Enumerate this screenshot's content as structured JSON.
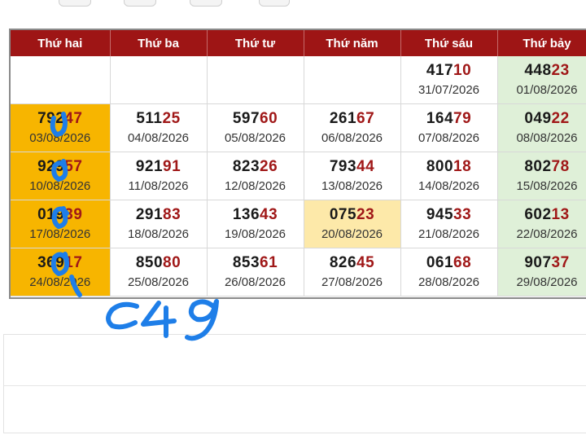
{
  "colors": {
    "header_bg": "#9e1515",
    "number_tail": "#a01818",
    "monday_bg": "#f7b500",
    "saturday_bg": "#dff0d8",
    "highlight_bg": "#fde9a9",
    "scribble": "#1e7ee8"
  },
  "calendar": {
    "headers": [
      "Thứ hai",
      "Thứ ba",
      "Thứ tư",
      "Thứ năm",
      "Thứ sáu",
      "Thứ bảy"
    ],
    "rows": [
      [
        {
          "num_head": "",
          "num_tail": "",
          "date": ""
        },
        {
          "num_head": "",
          "num_tail": "",
          "date": ""
        },
        {
          "num_head": "",
          "num_tail": "",
          "date": ""
        },
        {
          "num_head": "",
          "num_tail": "",
          "date": ""
        },
        {
          "num_head": "417",
          "num_tail": "10",
          "date": "31/07/2026"
        },
        {
          "num_head": "448",
          "num_tail": "23",
          "date": "01/08/2026"
        }
      ],
      [
        {
          "num_head": "792",
          "num_tail": "47",
          "date": "03/08/2026"
        },
        {
          "num_head": "511",
          "num_tail": "25",
          "date": "04/08/2026"
        },
        {
          "num_head": "597",
          "num_tail": "60",
          "date": "05/08/2026"
        },
        {
          "num_head": "261",
          "num_tail": "67",
          "date": "06/08/2026"
        },
        {
          "num_head": "164",
          "num_tail": "79",
          "date": "07/08/2026"
        },
        {
          "num_head": "049",
          "num_tail": "22",
          "date": "08/08/2026"
        }
      ],
      [
        {
          "num_head": "929",
          "num_tail": "57",
          "date": "10/08/2026"
        },
        {
          "num_head": "921",
          "num_tail": "91",
          "date": "11/08/2026"
        },
        {
          "num_head": "823",
          "num_tail": "26",
          "date": "12/08/2026"
        },
        {
          "num_head": "793",
          "num_tail": "44",
          "date": "13/08/2026"
        },
        {
          "num_head": "800",
          "num_tail": "18",
          "date": "14/08/2026"
        },
        {
          "num_head": "802",
          "num_tail": "78",
          "date": "15/08/2026"
        }
      ],
      [
        {
          "num_head": "019",
          "num_tail": "39",
          "date": "17/08/2026"
        },
        {
          "num_head": "291",
          "num_tail": "83",
          "date": "18/08/2026"
        },
        {
          "num_head": "136",
          "num_tail": "43",
          "date": "19/08/2026"
        },
        {
          "num_head": "075",
          "num_tail": "23",
          "date": "20/08/2026"
        },
        {
          "num_head": "945",
          "num_tail": "33",
          "date": "21/08/2026"
        },
        {
          "num_head": "602",
          "num_tail": "13",
          "date": "22/08/2026"
        }
      ],
      [
        {
          "num_head": "369",
          "num_tail": "17",
          "date": "24/08/2026"
        },
        {
          "num_head": "850",
          "num_tail": "80",
          "date": "25/08/2026"
        },
        {
          "num_head": "853",
          "num_tail": "61",
          "date": "26/08/2026"
        },
        {
          "num_head": "826",
          "num_tail": "45",
          "date": "27/08/2026"
        },
        {
          "num_head": "061",
          "num_tail": "68",
          "date": "28/08/2026"
        },
        {
          "num_head": "907",
          "num_tail": "37",
          "date": "29/08/2026"
        }
      ]
    ],
    "highlighted_date": "20/08/2026"
  },
  "annotation": {
    "handwritten_text": "c49"
  }
}
